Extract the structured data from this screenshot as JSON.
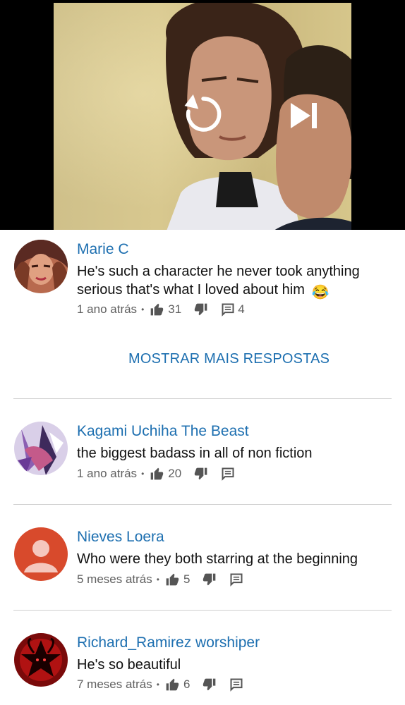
{
  "video": {
    "controls": {
      "replay_icon": "replay-icon",
      "next_icon": "skip-next-icon"
    }
  },
  "comments": [
    {
      "author": "Marie C",
      "text": "He's such a character he never took anything serious that's what I loved about him",
      "emoji": "😂",
      "time": "1 ano atrás",
      "likes": "31",
      "replies": "4"
    },
    {
      "author": "Kagami Uchiha The Beast",
      "text": "the biggest badass in all of non fiction",
      "time": "1 ano atrás",
      "likes": "20",
      "replies": ""
    },
    {
      "author": "Nieves Loera",
      "text": "Who were they both starring at the beginning",
      "time": "5 meses atrás",
      "likes": "5",
      "replies": ""
    },
    {
      "author": "Richard_Ramirez worshiper",
      "text": "He's so beautiful",
      "time": "7 meses atrás",
      "likes": "6",
      "replies": ""
    }
  ],
  "show_more_replies": "MOSTRAR MAIS RESPOSTAS",
  "meta_separator": "•",
  "colors": {
    "link": "#1d6fb0",
    "meta": "#606060",
    "divider": "#cfcfcf"
  }
}
